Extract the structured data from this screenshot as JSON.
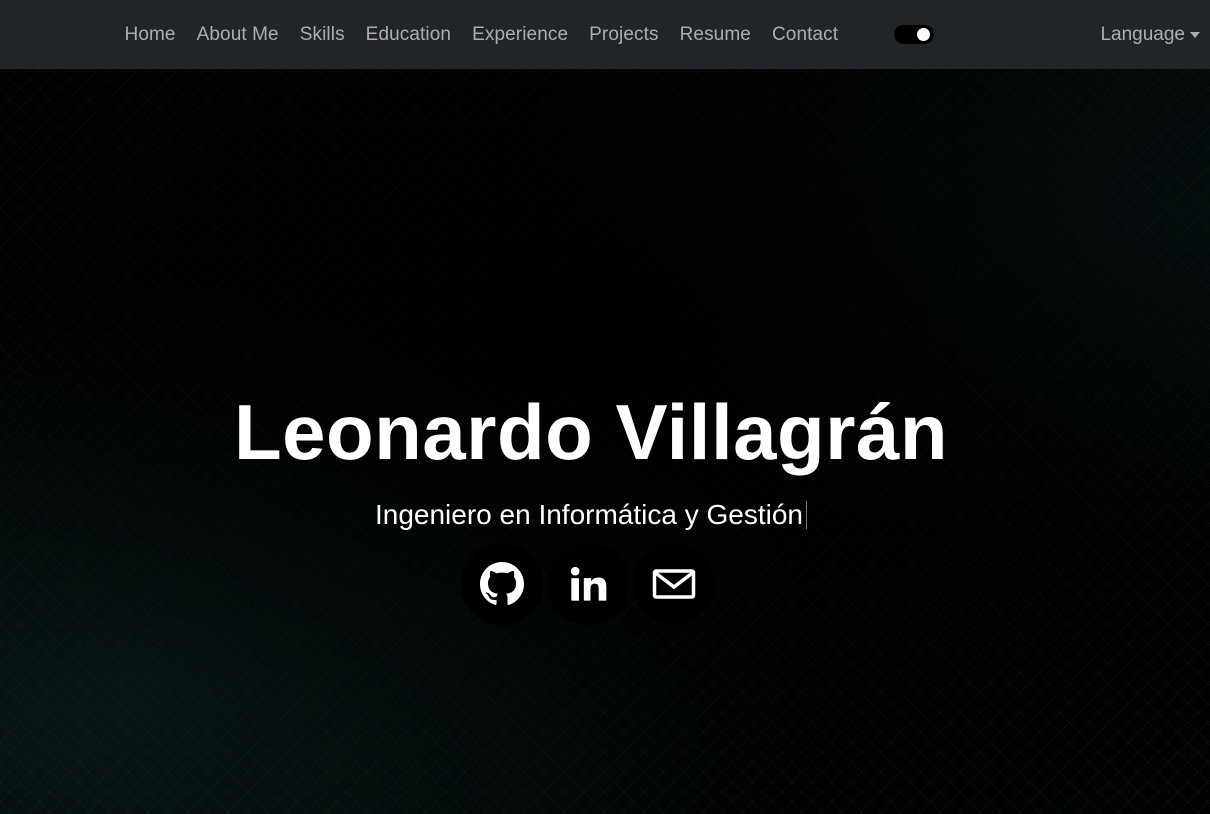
{
  "nav": {
    "links": [
      "Home",
      "About Me",
      "Skills",
      "Education",
      "Experience",
      "Projects",
      "Resume",
      "Contact"
    ],
    "theme_toggle": {
      "state": "on",
      "icon": "toggle-switch"
    },
    "language_label": "Language"
  },
  "hero": {
    "name": "Leonardo Villagrán",
    "subtitle": "Ingeniero en Informática y Gestión",
    "socials": [
      {
        "icon": "github-icon"
      },
      {
        "icon": "linkedin-icon"
      },
      {
        "icon": "mail-icon"
      }
    ]
  },
  "colors": {
    "navbar_bg": "#212529",
    "nav_text": "#9fa1a4",
    "hero_bg": "#020303",
    "text": "#ffffff"
  }
}
